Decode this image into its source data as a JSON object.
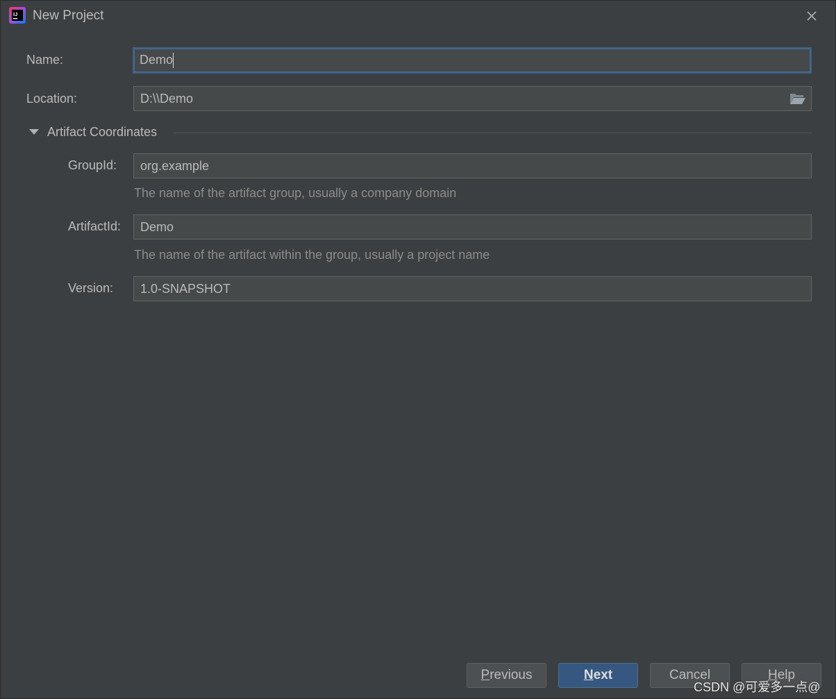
{
  "window": {
    "title": "New Project",
    "app_icon": "intellij-idea-icon",
    "close_icon": "close-icon"
  },
  "form": {
    "name": {
      "label": "Name:",
      "value": "Demo"
    },
    "location": {
      "label": "Location:",
      "value": "D:\\\\Demo",
      "browse_icon": "folder-open-icon"
    },
    "artifact_section": {
      "title": "Artifact Coordinates",
      "toggle_icon": "triangle-down-icon",
      "expanded": true
    },
    "group_id": {
      "label": "GroupId:",
      "value": "org.example",
      "hint": "The name of the artifact group, usually a company domain"
    },
    "artifact_id": {
      "label": "ArtifactId:",
      "value": "Demo",
      "hint": "The name of the artifact within the group, usually a project name"
    },
    "version": {
      "label": "Version:",
      "value": "1.0-SNAPSHOT"
    }
  },
  "buttons": {
    "previous": {
      "mnemonic": "P",
      "rest": "revious"
    },
    "next": {
      "mnemonic": "N",
      "rest": "ext"
    },
    "cancel": "Cancel",
    "help": {
      "mnemonic": "H",
      "rest": "elp"
    }
  },
  "watermark": "CSDN @可爱多一点@",
  "colors": {
    "background": "#3c3f41",
    "field_background": "#45494a",
    "focus_border": "#3d6185",
    "default_button": "#365880"
  }
}
